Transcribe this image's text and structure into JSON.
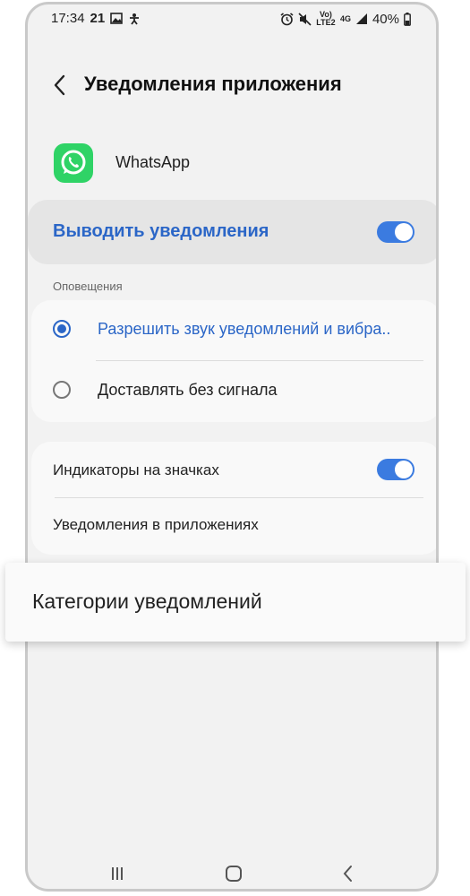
{
  "status_bar": {
    "time": "17:34",
    "extra": "21",
    "volte": "Vo)\nLTE2",
    "network": "4G",
    "battery": "40%"
  },
  "header": {
    "title": "Уведомления приложения"
  },
  "app": {
    "name": "WhatsApp",
    "icon": "whatsapp-icon"
  },
  "master": {
    "label": "Выводить уведомления",
    "enabled": true
  },
  "alerts": {
    "section_label": "Оповещения",
    "options": [
      {
        "label": "Разрешить звук уведомлений и вибра..",
        "selected": true
      },
      {
        "label": "Доставлять без сигнала",
        "selected": false
      }
    ]
  },
  "other": {
    "badges_label": "Индикаторы на значках",
    "badges_enabled": true,
    "in_app_label": "Уведомления в приложениях"
  },
  "categories": {
    "label": "Категории уведомлений"
  },
  "colors": {
    "accent": "#2b66c7",
    "toggle_on": "#3b7be0",
    "whatsapp_green": "#2fd366"
  }
}
